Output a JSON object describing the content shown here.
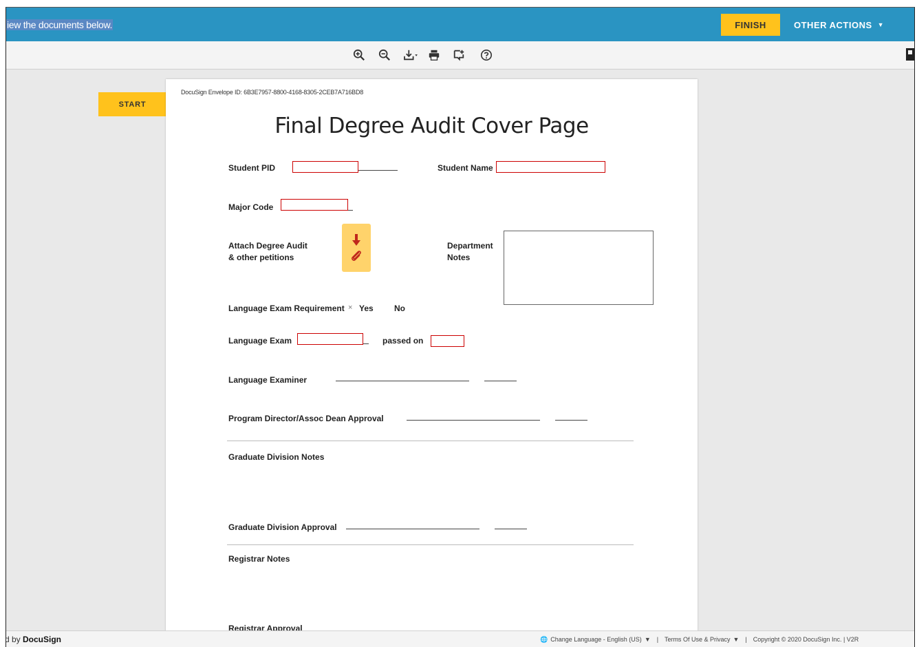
{
  "topbar": {
    "message": "iew the documents below.",
    "finish_label": "FINISH",
    "other_actions_label": "OTHER ACTIONS",
    "accent_color": "#2a94c2",
    "button_color": "#ffc21c"
  },
  "toolbar": {
    "icons": [
      "zoom-in-icon",
      "zoom-out-icon",
      "download-icon",
      "print-icon",
      "comment-icon",
      "help-icon"
    ]
  },
  "start_label": "START",
  "document": {
    "envelope_id": "DocuSign Envelope ID: 6B3E7957-8800-4168-8305-2CEB7A716BD8",
    "title": "Final Degree Audit Cover Page",
    "student_pid_label": "Student PID",
    "student_name_label": "Student Name",
    "major_code_label": "Major Code",
    "attach_label_1": "Attach Degree Audit",
    "attach_label_2": "& other petitions",
    "dept_notes_label_1": "Department",
    "dept_notes_label_2": "Notes",
    "lang_req_label": "Language Exam Requirement",
    "lang_req_mark": "×",
    "yes_label": "Yes",
    "no_label": "No",
    "lang_exam_label": "Language Exam",
    "passed_on_label": "passed on",
    "lang_examiner_label": "Language Examiner",
    "program_director_label": "Program Director/Assoc Dean Approval",
    "grad_notes_label": "Graduate Division Notes",
    "grad_approval_label": "Graduate Division Approval",
    "registrar_notes_label": "Registrar Notes",
    "registrar_approval_label": "Registrar Approval"
  },
  "footer": {
    "brand_prefix": "d by ",
    "brand_name": "DocuSign",
    "change_language": "Change Language - English (US)",
    "terms": "Terms Of Use & Privacy",
    "copyright": "Copyright © 2020 DocuSign Inc. | V2R"
  }
}
